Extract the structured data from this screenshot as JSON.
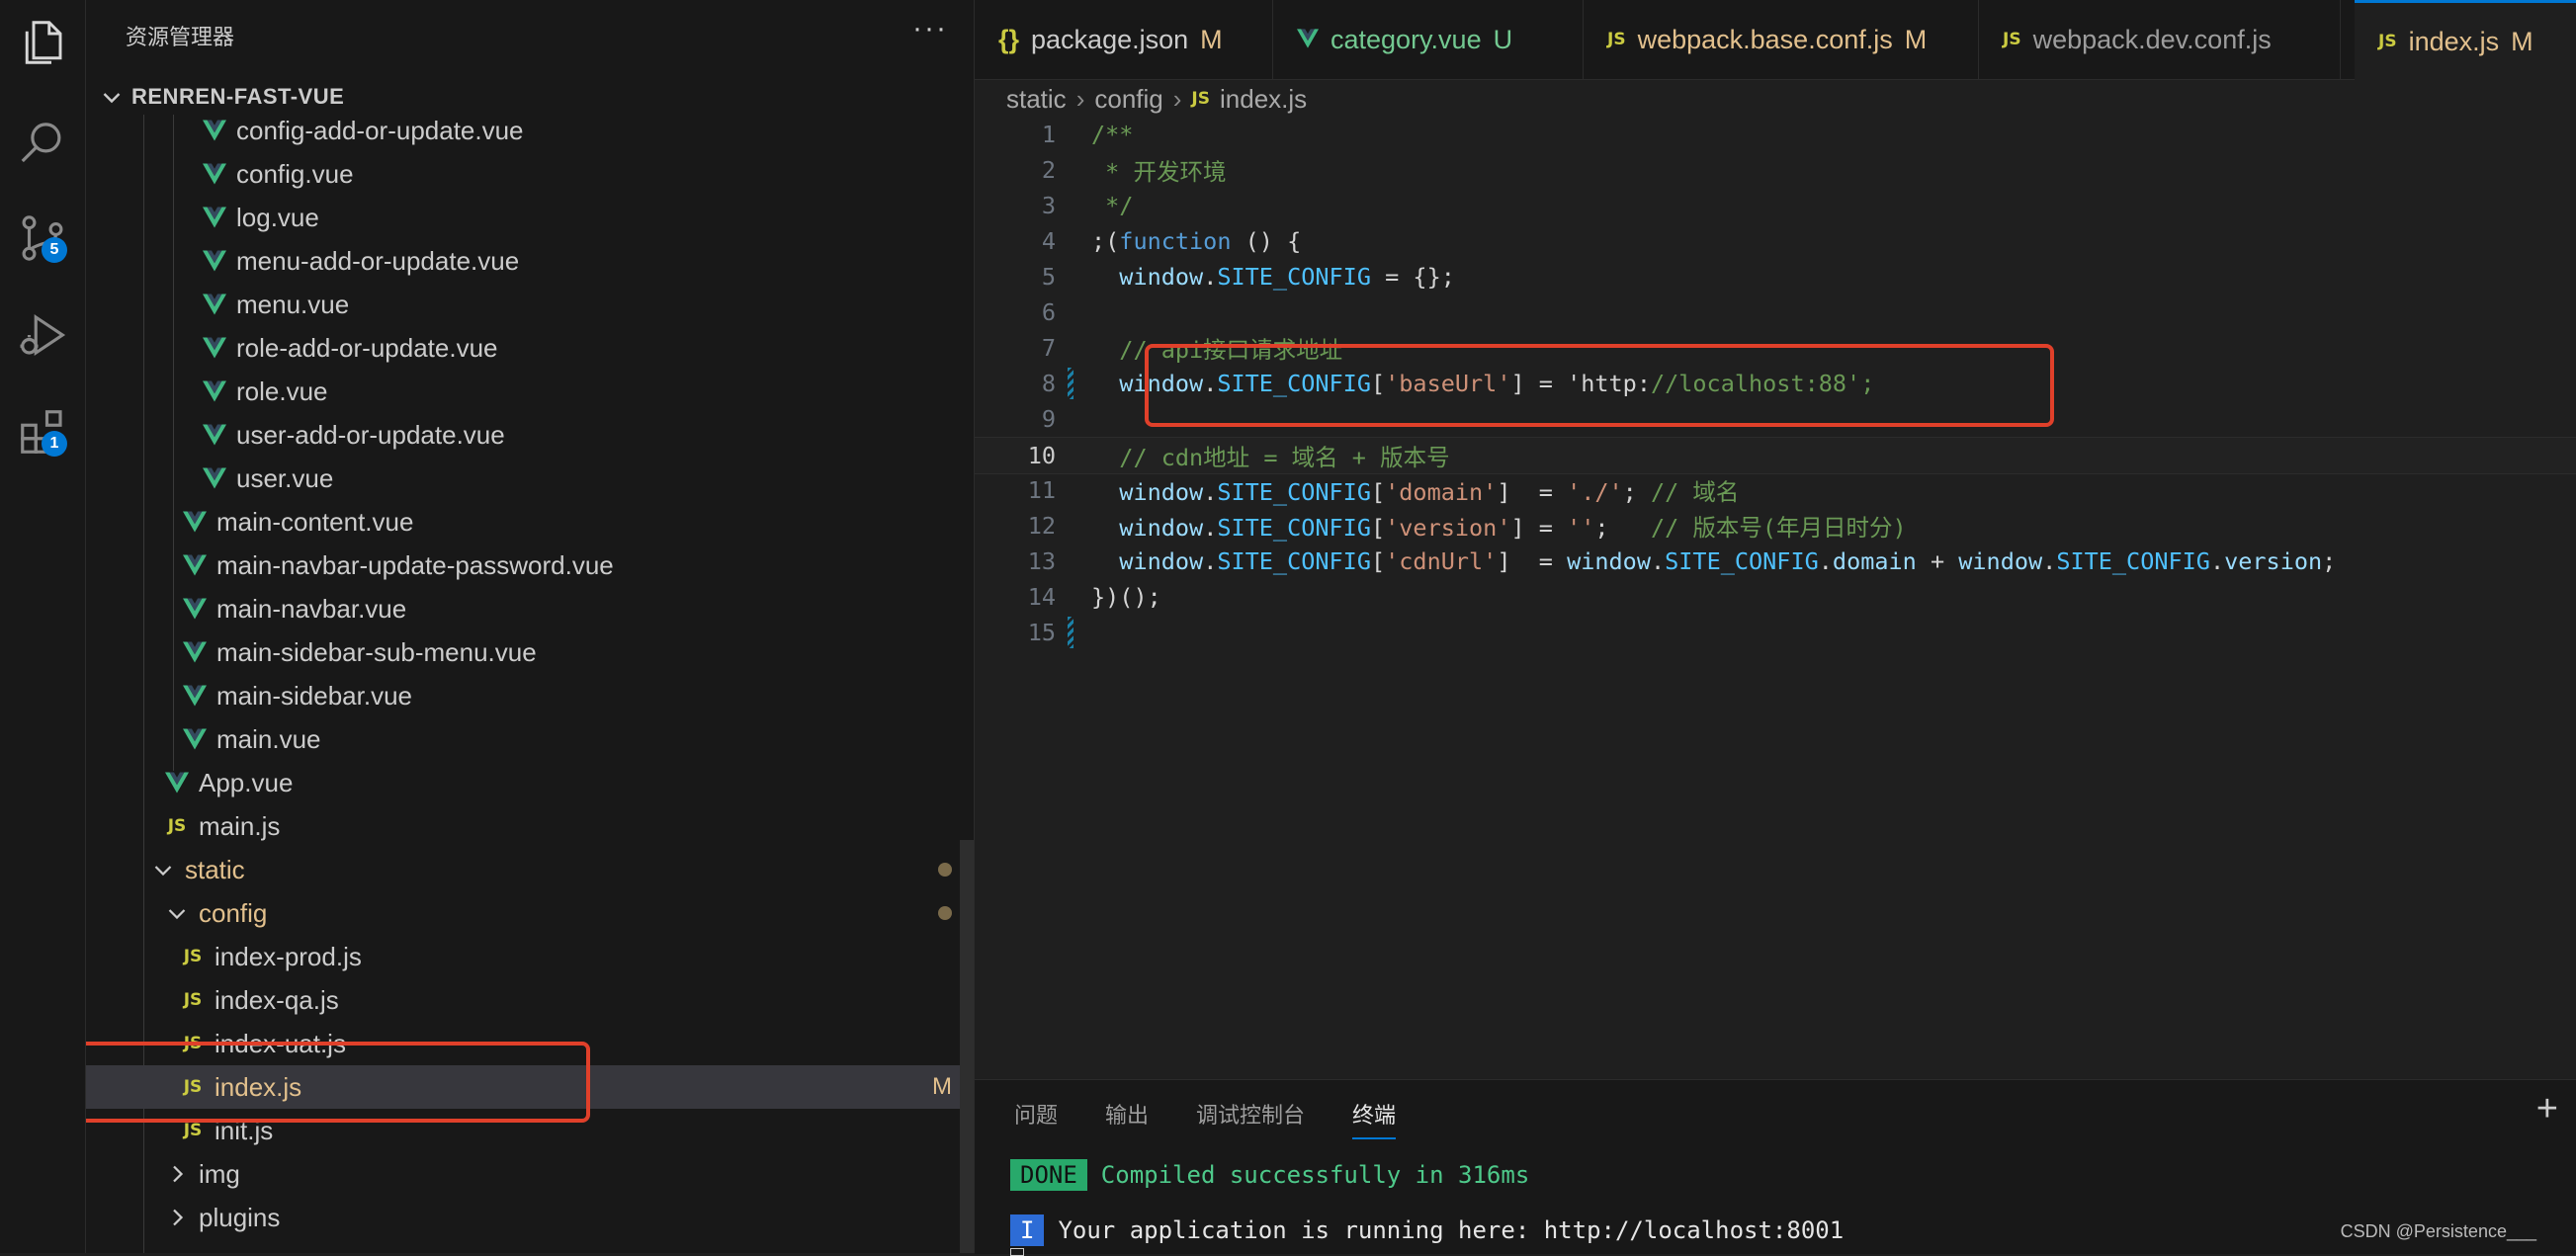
{
  "colors": {
    "accent": "#0078d4",
    "modified": "#e2c08d",
    "untracked": "#73c991",
    "highlight_box": "#e0402a",
    "vue_icon": "#41b883",
    "js_icon": "#cbcb41"
  },
  "activity_bar": {
    "items": [
      {
        "icon": "files-icon"
      },
      {
        "icon": "search-icon"
      },
      {
        "icon": "source-control-icon",
        "badge": "5"
      },
      {
        "icon": "run-debug-icon"
      },
      {
        "icon": "extensions-icon",
        "badge": "1"
      }
    ]
  },
  "explorer": {
    "title": "资源管理器",
    "more": "···",
    "section_title": "RENREN-FAST-VUE",
    "items": [
      {
        "label": "config-add-or-update.vue",
        "type": "vue"
      },
      {
        "label": "config.vue",
        "type": "vue"
      },
      {
        "label": "log.vue",
        "type": "vue"
      },
      {
        "label": "menu-add-or-update.vue",
        "type": "vue"
      },
      {
        "label": "menu.vue",
        "type": "vue"
      },
      {
        "label": "role-add-or-update.vue",
        "type": "vue"
      },
      {
        "label": "role.vue",
        "type": "vue"
      },
      {
        "label": "user-add-or-update.vue",
        "type": "vue"
      },
      {
        "label": "user.vue",
        "type": "vue"
      },
      {
        "label": "main-content.vue",
        "type": "vue"
      },
      {
        "label": "main-navbar-update-password.vue",
        "type": "vue"
      },
      {
        "label": "main-navbar.vue",
        "type": "vue"
      },
      {
        "label": "main-sidebar-sub-menu.vue",
        "type": "vue"
      },
      {
        "label": "main-sidebar.vue",
        "type": "vue"
      },
      {
        "label": "main.vue",
        "type": "vue"
      },
      {
        "label": "App.vue",
        "type": "vue"
      },
      {
        "label": "main.js",
        "type": "js"
      },
      {
        "label": "static",
        "type": "folder-open"
      },
      {
        "label": "config",
        "type": "folder-open"
      },
      {
        "label": "index-prod.js",
        "type": "js"
      },
      {
        "label": "index-qa.js",
        "type": "js"
      },
      {
        "label": "index-uat.js",
        "type": "js"
      },
      {
        "label": "index.js",
        "type": "js",
        "status": "M",
        "selected": true
      },
      {
        "label": "init.js",
        "type": "js"
      },
      {
        "label": "img",
        "type": "folder-closed"
      },
      {
        "label": "plugins",
        "type": "folder-closed"
      }
    ]
  },
  "tabs": [
    {
      "icon": "{}",
      "label": "package.json",
      "status": "M"
    },
    {
      "icon": "vue-icon",
      "label": "category.vue",
      "status": "U"
    },
    {
      "icon": "JS",
      "label": "webpack.base.conf.js",
      "status": "M"
    },
    {
      "icon": "JS",
      "label": "webpack.dev.conf.js",
      "status": ""
    },
    {
      "icon": "JS",
      "label": "index.js",
      "status": "M",
      "active": true
    }
  ],
  "breadcrumb": {
    "parts": [
      "static",
      "config"
    ],
    "file_icon": "JS",
    "file": "index.js"
  },
  "editor": {
    "current_line": 10,
    "lines": [
      {
        "n": "1",
        "text": "/**"
      },
      {
        "n": "2",
        "text": " * 开发环境"
      },
      {
        "n": "3",
        "text": " */"
      },
      {
        "n": "4",
        "text": ";(function () {"
      },
      {
        "n": "5",
        "text": "  window.SITE_CONFIG = {};"
      },
      {
        "n": "6",
        "text": ""
      },
      {
        "n": "7",
        "text": "  // api接口请求地址"
      },
      {
        "n": "8",
        "text": "  window.SITE_CONFIG['baseUrl'] = 'http://localhost:88';"
      },
      {
        "n": "9",
        "text": ""
      },
      {
        "n": "10",
        "text": "  // cdn地址 = 域名 + 版本号"
      },
      {
        "n": "11",
        "text": "  window.SITE_CONFIG['domain']  = './'; // 域名"
      },
      {
        "n": "12",
        "text": "  window.SITE_CONFIG['version'] = '';   // 版本号(年月日时分)"
      },
      {
        "n": "13",
        "text": "  window.SITE_CONFIG['cdnUrl']  = window.SITE_CONFIG.domain + window.SITE_CONFIG.version;"
      },
      {
        "n": "14",
        "text": "})();"
      },
      {
        "n": "15",
        "text": ""
      }
    ]
  },
  "panel": {
    "tabs": [
      "问题",
      "输出",
      "调试控制台",
      "终端"
    ],
    "active_tab": "终端",
    "add": "+",
    "terminal": {
      "line1_badge": "DONE",
      "line1_text": "Compiled successfully in 316ms",
      "line2_badge": "I",
      "line2_text": "Your application is running here: http://localhost:8001"
    }
  },
  "watermark": "CSDN @Persistence___"
}
